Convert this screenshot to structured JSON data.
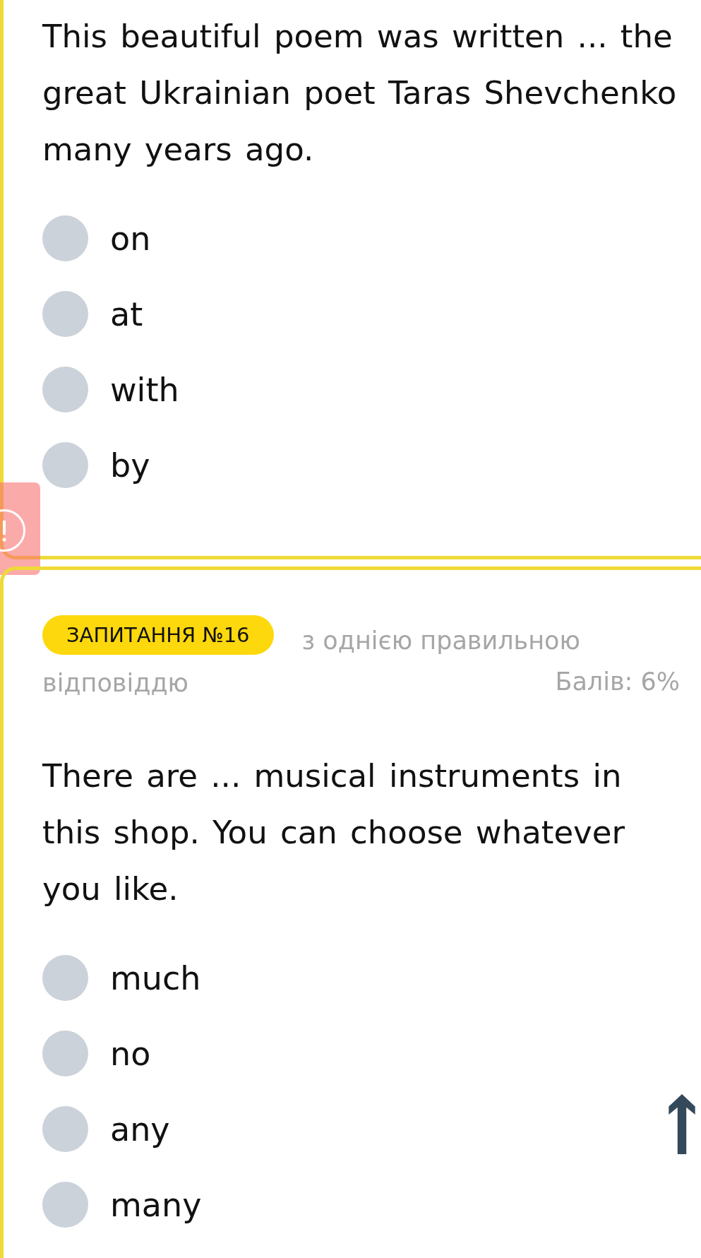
{
  "questions": [
    {
      "warning": true,
      "text": "This beautiful poem was written ... the great Ukrainian poet Taras Shevchenko many years ago.",
      "options": [
        {
          "label": "on",
          "selected": false
        },
        {
          "label": "at",
          "selected": false
        },
        {
          "label": "with",
          "selected": false
        },
        {
          "label": "by",
          "selected": false
        }
      ]
    },
    {
      "warning": false,
      "badge": "ЗАПИТАННЯ №16",
      "type_lines": [
        "з однією правильною",
        "відповіддю"
      ],
      "score": "Балів: 6%",
      "text": "There are ... musical instruments in this shop. You can choose whatever you like.",
      "options": [
        {
          "label": "much",
          "selected": false
        },
        {
          "label": "no",
          "selected": false
        },
        {
          "label": "any",
          "selected": false
        },
        {
          "label": "many",
          "selected": false
        }
      ]
    }
  ]
}
